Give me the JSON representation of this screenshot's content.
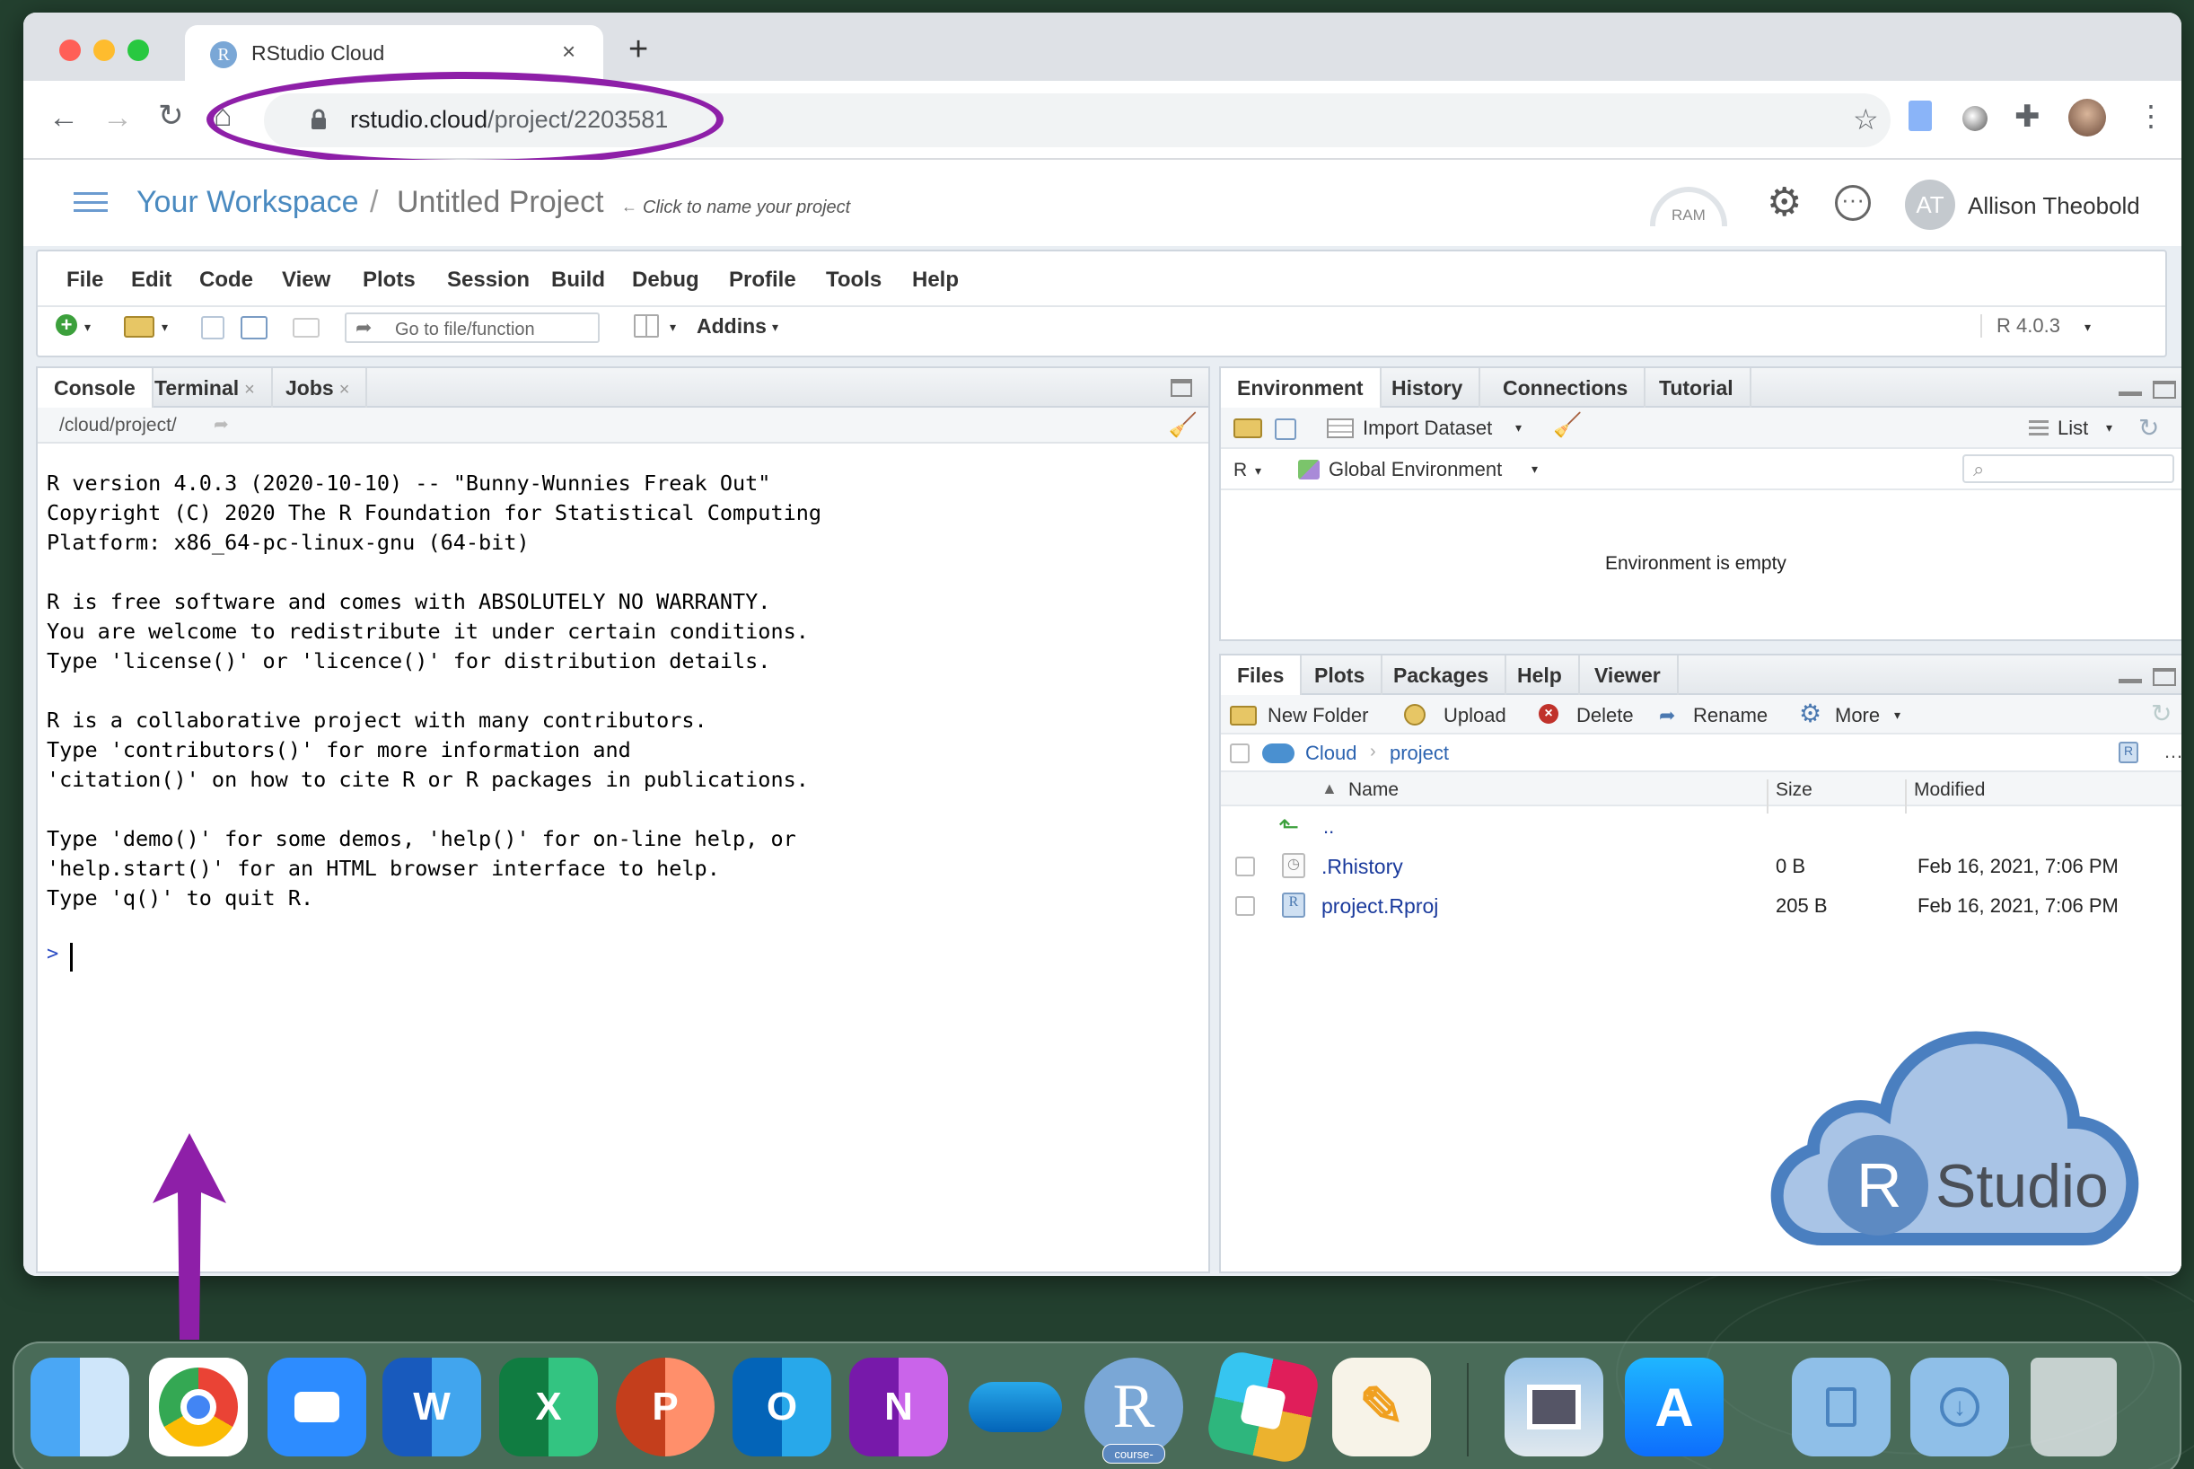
{
  "browser": {
    "tab_title": "RStudio Cloud",
    "url_host": "rstudio.cloud",
    "url_path": "/project/2203581"
  },
  "header": {
    "workspace": "Your Workspace",
    "separator": "/",
    "project": "Untitled Project",
    "name_hint": "Click to name your project",
    "ram_label": "RAM",
    "user_initials": "AT",
    "user_name": "Allison Theobold"
  },
  "menu": [
    "File",
    "Edit",
    "Code",
    "View",
    "Plots",
    "Session",
    "Build",
    "Debug",
    "Profile",
    "Tools",
    "Help"
  ],
  "toolbar": {
    "goto_placeholder": "Go to file/function",
    "addins": "Addins",
    "r_version": "R 4.0.3"
  },
  "console": {
    "tabs": [
      "Console",
      "Terminal",
      "Jobs"
    ],
    "path": "/cloud/project/",
    "lines": [
      "R version 4.0.3 (2020-10-10) -- \"Bunny-Wunnies Freak Out\"",
      "Copyright (C) 2020 The R Foundation for Statistical Computing",
      "Platform: x86_64-pc-linux-gnu (64-bit)",
      "",
      "R is free software and comes with ABSOLUTELY NO WARRANTY.",
      "You are welcome to redistribute it under certain conditions.",
      "Type 'license()' or 'licence()' for distribution details.",
      "",
      "R is a collaborative project with many contributors.",
      "Type 'contributors()' for more information and",
      "'citation()' on how to cite R or R packages in publications.",
      "",
      "Type 'demo()' for some demos, 'help()' for on-line help, or",
      "'help.start()' for an HTML browser interface to help.",
      "Type 'q()' to quit R."
    ],
    "prompt": ">"
  },
  "env": {
    "tabs": [
      "Environment",
      "History",
      "Connections",
      "Tutorial"
    ],
    "import_dataset": "Import Dataset",
    "list_label": "List",
    "r_label": "R",
    "global_env": "Global Environment",
    "empty_msg": "Environment is empty"
  },
  "files": {
    "tabs": [
      "Files",
      "Plots",
      "Packages",
      "Help",
      "Viewer"
    ],
    "actions": [
      "New Folder",
      "Upload",
      "Delete",
      "Rename",
      "More"
    ],
    "breadcrumb": [
      "Cloud",
      "project"
    ],
    "columns": [
      "Name",
      "Size",
      "Modified"
    ],
    "up": "..",
    "rows": [
      {
        "name": ".Rhistory",
        "size": "0 B",
        "modified": "Feb 16, 2021, 7:06 PM"
      },
      {
        "name": "project.Rproj",
        "size": "205 B",
        "modified": "Feb 16, 2021, 7:06 PM"
      }
    ]
  },
  "logo": {
    "r": "R",
    "studio": "Studio"
  },
  "dock": {
    "badge": "course-",
    "apps": [
      "finder",
      "chrome",
      "zoom",
      "word",
      "excel",
      "powerpoint",
      "outlook",
      "onenote",
      "onedrive",
      "rstudio",
      "slack",
      "pages",
      "preview",
      "app-store",
      "documents-folder",
      "downloads-folder",
      "trash"
    ],
    "letters": {
      "word": "W",
      "excel": "X",
      "powerpoint": "P",
      "outlook": "O",
      "onenote": "N"
    }
  },
  "colors": {
    "annotation": "#8e1fa8",
    "rstudio_blue": "#4a78b0",
    "link": "#1a3a9c"
  }
}
